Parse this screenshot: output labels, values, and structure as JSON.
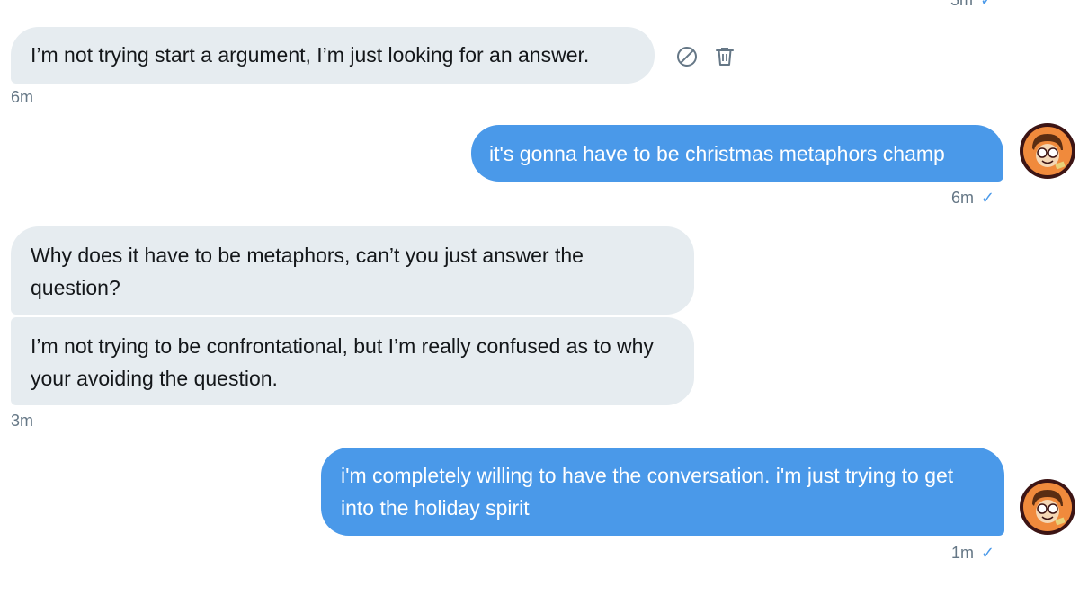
{
  "conversation": {
    "top_partial": {
      "time": "5m"
    },
    "messages": [
      {
        "sender": "them",
        "text": "I’m not trying start a argument, I’m just looking for an answer.",
        "time": "6m"
      },
      {
        "sender": "me",
        "text": "it's gonna have to be christmas metaphors champ",
        "time": "6m"
      },
      {
        "sender": "them",
        "text": "Why does it have to be metaphors, can’t you just answer the question?"
      },
      {
        "sender": "them",
        "text": "I’m not trying to be confrontational, but I’m really confused as to why your avoiding the question.",
        "time": "3m"
      },
      {
        "sender": "me",
        "text": "i'm completely willing to have the conversation. i'm just trying to get into the holiday spirit",
        "time": "1m"
      }
    ],
    "read_mark": "✓"
  },
  "icons": {
    "block": "block-icon",
    "delete": "trash-icon",
    "avatar": "avatar-cartoon-image"
  },
  "colors": {
    "incoming_bubble": "#e6ecf0",
    "outgoing_bubble": "#4a99e9",
    "timestamp": "#657786",
    "read_check": "#4a99e9",
    "avatar_ring": "#3c1414",
    "avatar_bg": "#f08a3c"
  }
}
